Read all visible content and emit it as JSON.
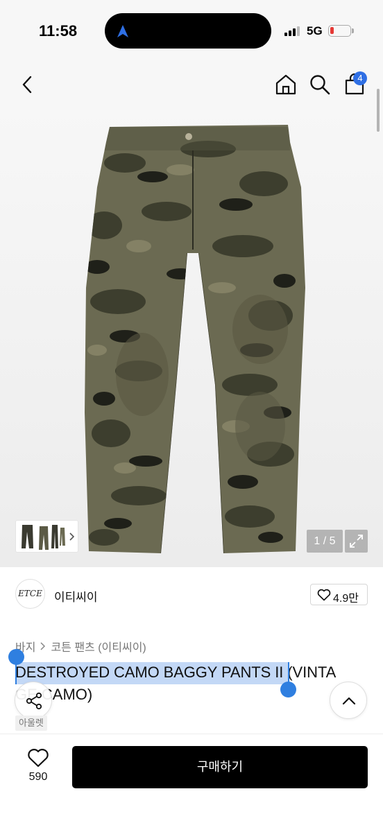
{
  "status_bar": {
    "time": "11:58",
    "network": "5G",
    "battery_level": 0.15,
    "battery_color": "#e53935"
  },
  "header": {
    "back_icon": "chevron-left-icon",
    "home_icon": "home-icon",
    "search_icon": "search-icon",
    "cart_icon": "shopping-bag-icon",
    "cart_badge": "4",
    "badge_color": "#2f6fe4"
  },
  "gallery": {
    "counter": "1 / 5",
    "expand_icon": "expand-icon"
  },
  "brand": {
    "logo_text": "ETCE",
    "name": "이티씨이",
    "likes": "4.9만"
  },
  "breadcrumb": {
    "category": "바지",
    "subcategory": "코튼 팬츠 (이티씨이)"
  },
  "product": {
    "title_selected": "DESTROYED CAMO BAGGY PANTS",
    "title_rest": " II (VINTA",
    "title_line2": "GE CAMO)",
    "seller_tag": "아울렛"
  },
  "bottom_bar": {
    "wish_count": "590",
    "buy_label": "구매하기"
  },
  "colors": {
    "selection": "#2f7fe0",
    "buy_button": "#000000"
  }
}
